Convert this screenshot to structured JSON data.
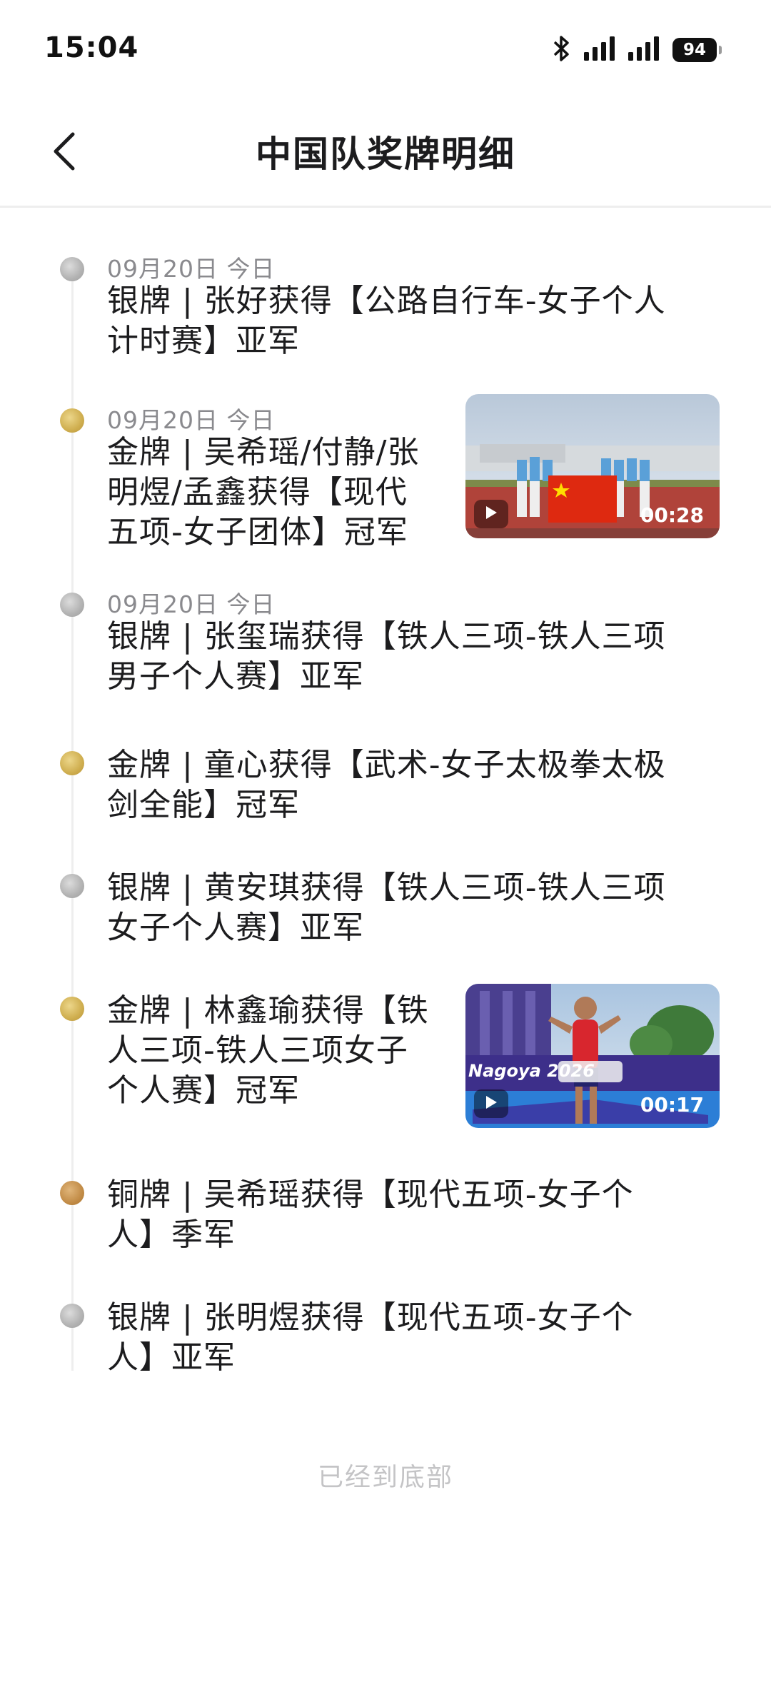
{
  "status_bar": {
    "time": "15:04",
    "battery": "94",
    "icons": [
      "bluetooth-icon",
      "signal-icon",
      "signal-icon"
    ]
  },
  "header": {
    "back_icon": "chevron-left-icon",
    "title": "中国队奖牌明细"
  },
  "medal_colors": {
    "gold": "#cfae4f",
    "silver": "#b2b2b2",
    "bronze": "#c28c47"
  },
  "items": [
    {
      "medal": "silver",
      "date": "09月20日 今日",
      "lines": [
        "银牌 | 张好获得【公路自行车-女子个人",
        "计时赛】亚军"
      ]
    },
    {
      "medal": "gold",
      "date": "09月20日 今日",
      "lines": [
        "金牌 | 吴希瑶/付静/张",
        "明煜/孟鑫获得【现代",
        "五项-女子团体】冠军"
      ],
      "video": {
        "duration": "00:28"
      }
    },
    {
      "medal": "silver",
      "date": "09月20日 今日",
      "lines": [
        "银牌 | 张玺瑞获得【铁人三项-铁人三项",
        "男子个人赛】亚军"
      ]
    },
    {
      "medal": "gold",
      "lines": [
        "金牌 | 童心获得【武术-女子太极拳太极",
        "剑全能】冠军"
      ]
    },
    {
      "medal": "silver",
      "lines": [
        "银牌 | 黄安琪获得【铁人三项-铁人三项",
        "女子个人赛】亚军"
      ]
    },
    {
      "medal": "gold",
      "lines": [
        "金牌 | 林鑫瑜获得【铁",
        "人三项-铁人三项女子",
        "个人赛】冠军"
      ],
      "video": {
        "duration": "00:17",
        "banner": "Nagoya 2026"
      }
    },
    {
      "medal": "bronze",
      "lines": [
        "铜牌 | 吴希瑶获得【现代五项-女子个",
        "人】季军"
      ]
    },
    {
      "medal": "silver",
      "lines": [
        "银牌 | 张明煜获得【现代五项-女子个",
        "人】亚军"
      ]
    }
  ],
  "footer": {
    "end_text": "已经到底部"
  }
}
